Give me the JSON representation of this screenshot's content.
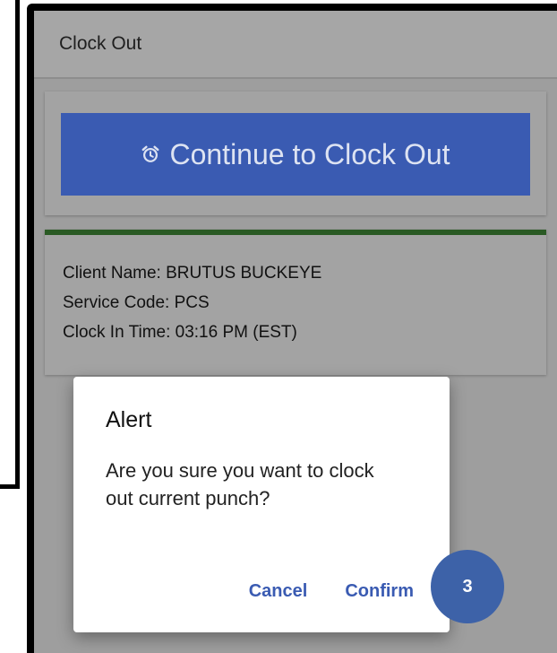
{
  "header": {
    "title": "Clock Out"
  },
  "action_card": {
    "button_label": "Continue to Clock Out",
    "icon": "alarm-clock-icon"
  },
  "info_card": {
    "lines": [
      "Client Name: BRUTUS BUCKEYE",
      "Service Code: PCS",
      "Clock In Time: 03:16 PM (EST)"
    ],
    "accent_color": "#2a5a24"
  },
  "dialog": {
    "title": "Alert",
    "message": "Are you sure you want to clock out current punch?",
    "cancel_label": "Cancel",
    "confirm_label": "Confirm"
  },
  "step_badge": {
    "number": "3"
  },
  "colors": {
    "primary": "#3a5bb2",
    "badge": "#3d62a8"
  }
}
